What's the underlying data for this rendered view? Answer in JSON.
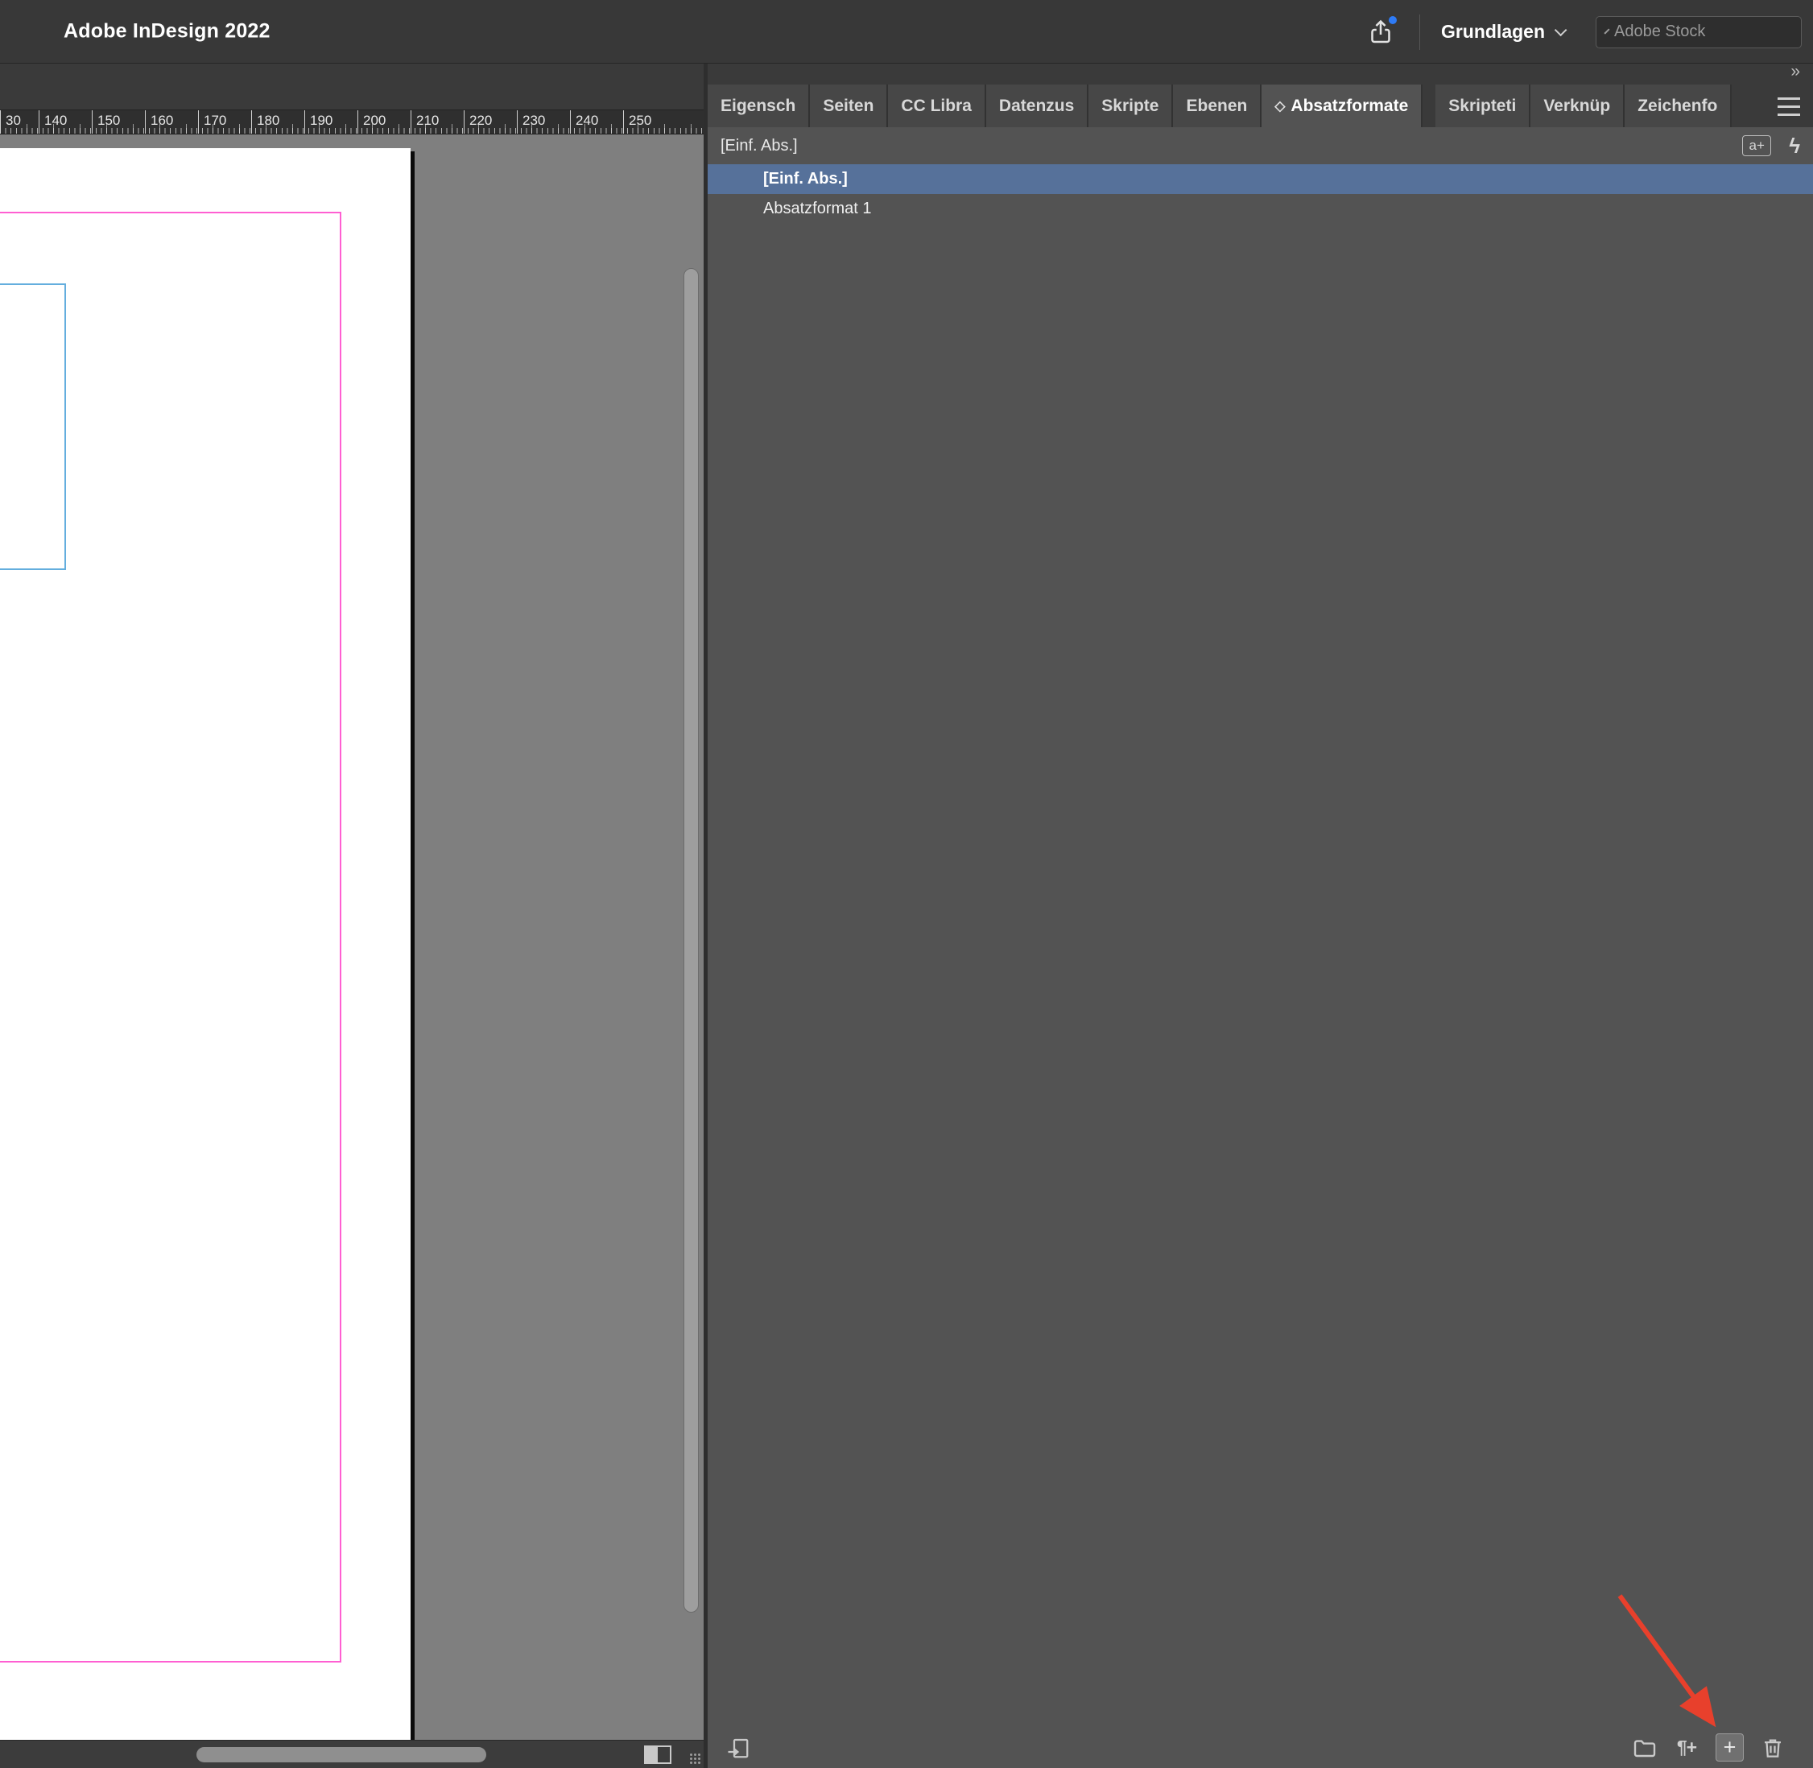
{
  "colors": {
    "accent-selection": "#56719a",
    "margin-guide": "#ff5fd2",
    "frame-guide": "#64aede",
    "arrow-red": "#e8402c",
    "share-dot-blue": "#2e7bf6"
  },
  "titlebar": {
    "app_title": "Adobe InDesign 2022",
    "workspace": "Grundlagen",
    "search_placeholder": "Adobe Stock"
  },
  "ruler": {
    "labels": [
      "30",
      "140",
      "150",
      "160",
      "170",
      "180",
      "190",
      "200",
      "210",
      "220",
      "230",
      "240",
      "250"
    ]
  },
  "panel": {
    "overflow_glyph": "»",
    "tabs": [
      {
        "label": "Eigensch",
        "active": false
      },
      {
        "label": "Seiten",
        "active": false
      },
      {
        "label": "CC Libra",
        "active": false
      },
      {
        "label": "Datenzus",
        "active": false
      },
      {
        "label": "Skripte",
        "active": false
      },
      {
        "label": "Ebenen",
        "active": false
      },
      {
        "label": "Absatzformate",
        "active": true,
        "icon": "◇"
      },
      {
        "label": "Skripteti",
        "active": false,
        "gap": true
      },
      {
        "label": "Verknüp",
        "active": false
      },
      {
        "label": "Zeichenfo",
        "active": false
      }
    ],
    "styles_header": {
      "current": "[Einf. Abs.]",
      "redefine": "a+",
      "quick_apply": "ϟ"
    },
    "styles": [
      {
        "label": "[Einf. Abs.]",
        "selected": true
      },
      {
        "label": "Absatzformat 1",
        "selected": false
      }
    ],
    "footer": {
      "clear_overrides": "¶+",
      "new_style": "+"
    }
  }
}
